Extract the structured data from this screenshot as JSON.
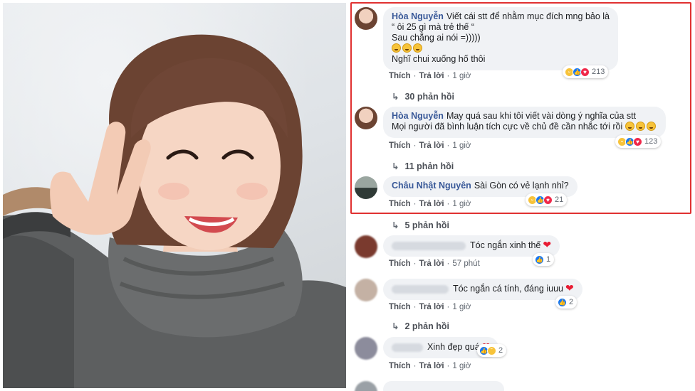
{
  "photo": {
    "alt": "selfie photo"
  },
  "comments": [
    {
      "author": "Hòa Nguyễn",
      "lines": [
        "Viết cái stt để nhằm mục đích mng bảo là",
        "“ ôi 25 gì mà trẻ thế “",
        "Sau chẳng ai nói =)))))",
        "",
        "Nghĩ chui xuống hố thôi"
      ],
      "like_label": "Thích",
      "reply_label": "Trả lời",
      "time": "1 giờ",
      "reaction_count": "213",
      "replies_label": "30 phản hồi"
    },
    {
      "author": "Hòa Nguyễn",
      "lines": [
        "May quá sau khi tôi viết vài dòng ý nghĩa của stt",
        "Mọi người đã bình luận tích cực về chủ đề cần nhắc tới rồi"
      ],
      "like_label": "Thích",
      "reply_label": "Trả lời",
      "time": "1 giờ",
      "reaction_count": "123",
      "replies_label": "11 phản hồi"
    },
    {
      "author": "Châu Nhật Nguyên",
      "lines": [
        "Sài Gòn có vẻ lạnh nhỉ?"
      ],
      "like_label": "Thích",
      "reply_label": "Trả lời",
      "time": "1 giờ",
      "reaction_count": "21",
      "replies_label": "5 phản hồi"
    },
    {
      "text": "Tóc ngắn xinh thế",
      "like_label": "Thích",
      "reply_label": "Trả lời",
      "time": "57 phút",
      "reaction_count": "1"
    },
    {
      "text": "Tóc ngắn cá tính, đáng iuuu",
      "like_label": "Thích",
      "reply_label": "Trả lời",
      "time": "1 giờ",
      "reaction_count": "2",
      "replies_label": "2 phản hồi"
    },
    {
      "text": "Xinh đẹp quá",
      "like_label": "Thích",
      "reply_label": "Trả lời",
      "time": "1 giờ",
      "reaction_count": "2"
    }
  ],
  "colors": {
    "highlight": "#e03131",
    "author": "#385898",
    "bubble": "#f0f2f5"
  }
}
